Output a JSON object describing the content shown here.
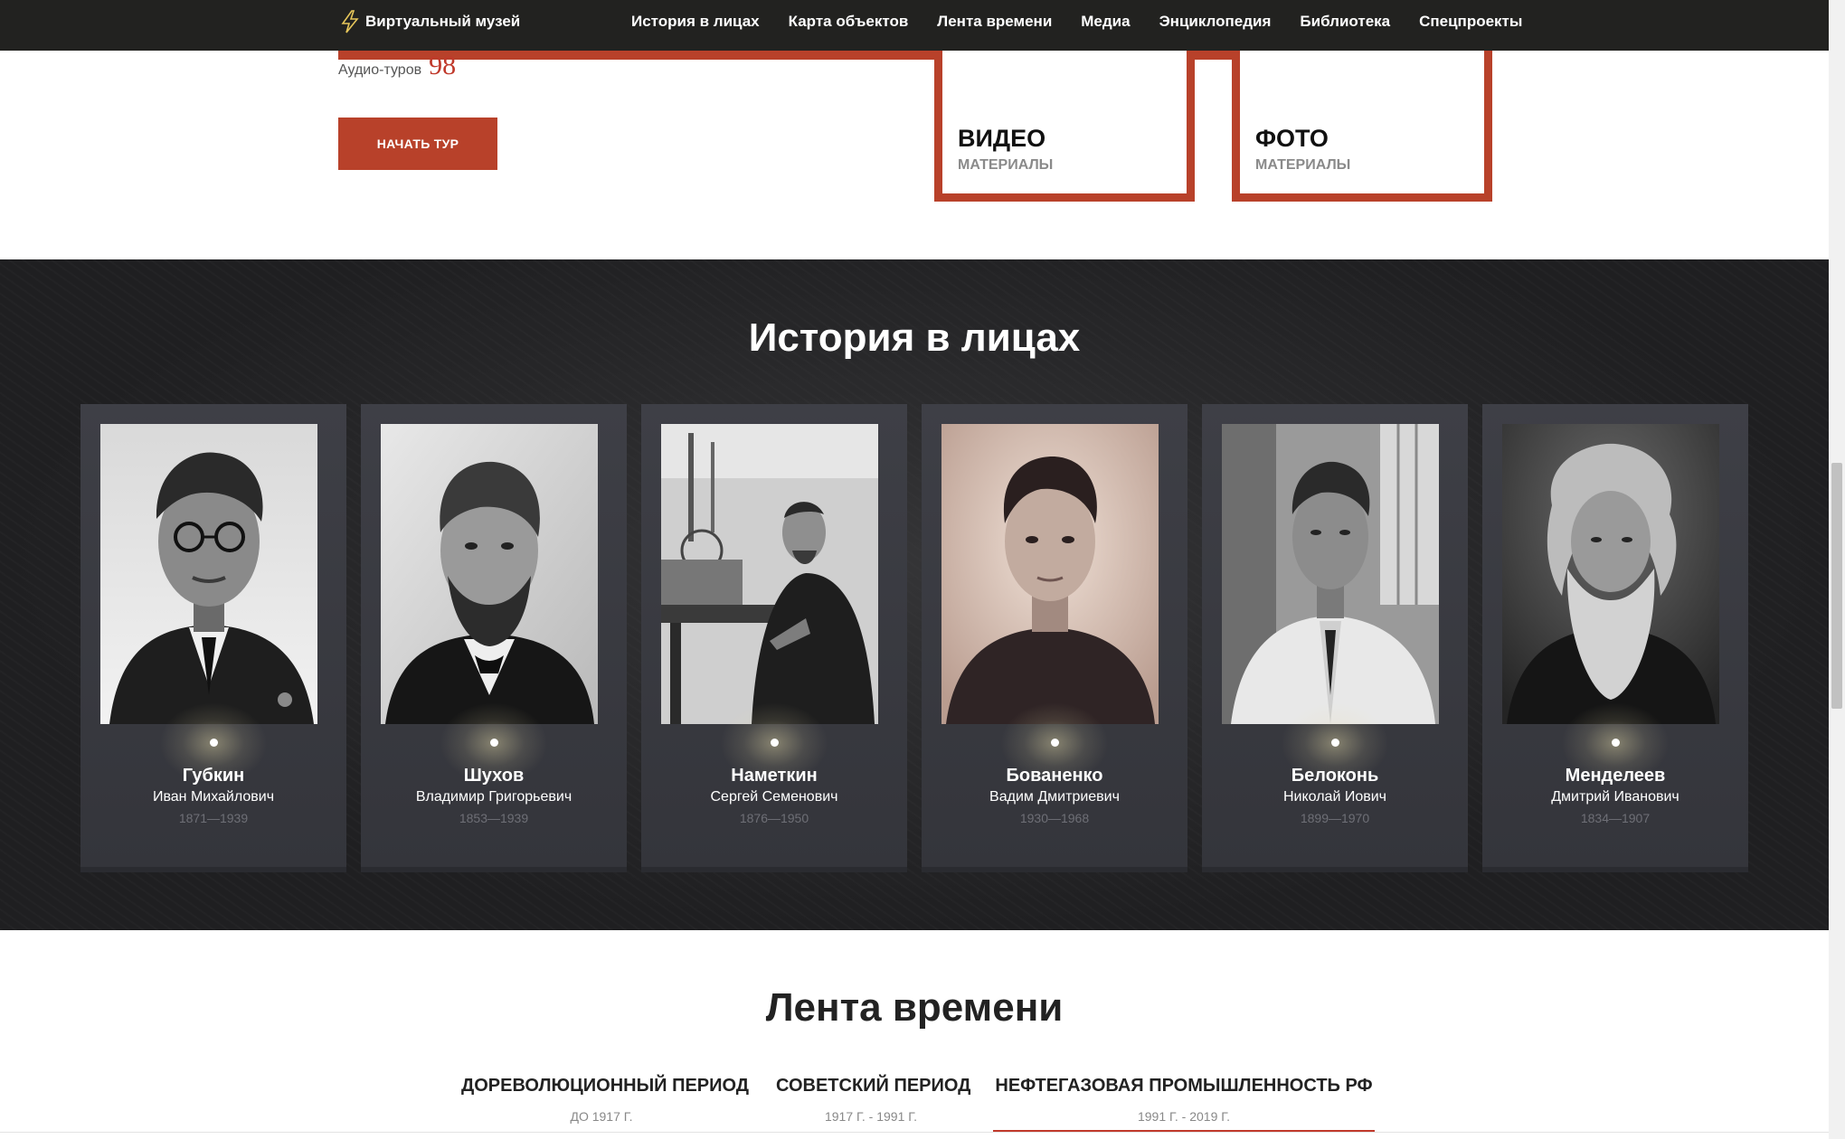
{
  "nav": {
    "logo_label": "Виртуальный музей",
    "logo_icon": "lightning-bolt-icon",
    "items": [
      {
        "label": "История в лицах"
      },
      {
        "label": "Карта объектов"
      },
      {
        "label": "Лента времени"
      },
      {
        "label": "Медиа"
      },
      {
        "label": "Энциклопедия"
      },
      {
        "label": "Библиотека"
      },
      {
        "label": "Спецпроекты"
      }
    ]
  },
  "tours": {
    "audio_label": "Аудио-туров",
    "audio_count": "98",
    "start_button": "НАЧАТЬ ТУР"
  },
  "media": {
    "video": {
      "title": "ВИДЕО",
      "subtitle": "МАТЕРИАЛЫ"
    },
    "photo": {
      "title": "ФОТО",
      "subtitle": "МАТЕРИАЛЫ"
    }
  },
  "faces": {
    "title": "История в лицах",
    "people": [
      {
        "surname": "Губкин",
        "given": "Иван Михайлович",
        "years": "1871—1939"
      },
      {
        "surname": "Шухов",
        "given": "Владимир Григорьевич",
        "years": "1853—1939"
      },
      {
        "surname": "Наметкин",
        "given": "Сергей Семенович",
        "years": "1876—1950"
      },
      {
        "surname": "Бованенко",
        "given": "Вадим Дмитриевич",
        "years": "1930—1968"
      },
      {
        "surname": "Белоконь",
        "given": "Николай Иович",
        "years": "1899—1970"
      },
      {
        "surname": "Менделеев",
        "given": "Дмитрий Иванович",
        "years": "1834—1907"
      }
    ]
  },
  "timeline": {
    "title": "Лента времени",
    "tabs": [
      {
        "title": "ДОРЕВОЛЮЦИОННЫЙ ПЕРИОД",
        "sub": "ДО 1917 Г."
      },
      {
        "title": "СОВЕТСКИЙ ПЕРИОД",
        "sub": "1917 Г. - 1991 Г."
      },
      {
        "title": "НЕФТЕГАЗОВАЯ ПРОМЫШЛЕННОСТЬ РФ",
        "sub": "1991 Г. - 2019 Г."
      }
    ],
    "active_tab": 2
  },
  "colors": {
    "accent": "#b8412a",
    "nav_bg": "#222220",
    "section_bg": "#1f1f21"
  }
}
